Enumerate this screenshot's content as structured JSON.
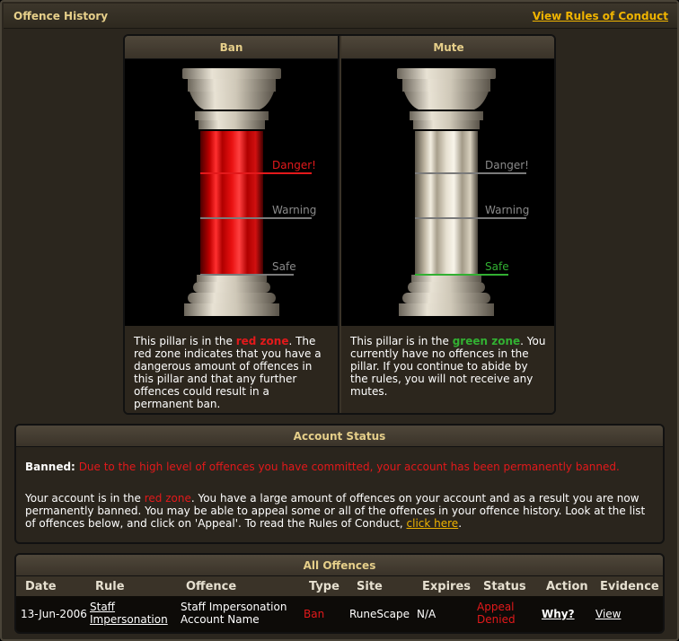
{
  "header": {
    "title": "Offence History",
    "rules_link": "View Rules of Conduct"
  },
  "pillars": [
    {
      "title": "Ban",
      "zone": "red",
      "fill_level": 1.0,
      "labels": {
        "danger": "Danger!",
        "warning": "Warning",
        "safe": "Safe"
      },
      "desc_before": "This pillar is in the ",
      "desc_zone": "red zone",
      "desc_after": ". The red zone indicates that you have a dangerous amount of offences in this pillar and that any further offences could result in a permanent ban."
    },
    {
      "title": "Mute",
      "zone": "green",
      "fill_level": 0.0,
      "labels": {
        "danger": "Danger!",
        "warning": "Warning",
        "safe": "Safe"
      },
      "desc_before": "This pillar is in the ",
      "desc_zone": "green zone",
      "desc_after": ". You currently have no offences in the pillar. If you continue to abide by the rules, you will not receive any mutes."
    }
  ],
  "account_status": {
    "title": "Account Status",
    "banned_label": "Banned:",
    "banned_text": "Due to the high level of offences you have committed, your account has been permanently banned.",
    "para_before": "Your account is in the ",
    "para_zone": "red zone",
    "para_after": ". You have a large amount of offences on your account and as a result you are now permanently banned. You may be able to appeal some or all of the offences in your offence history. Look at the list of offences below, and click on 'Appeal'. To read the Rules of Conduct, ",
    "click_here": "click here",
    "para_end": "."
  },
  "offences": {
    "title": "All Offences",
    "columns": [
      "Date",
      "Rule",
      "Offence",
      "Type",
      "Site",
      "Expires",
      "Status",
      "Action",
      "Evidence"
    ],
    "rows": [
      {
        "date": "13-Jun-2006",
        "rule_line1": "Staff",
        "rule_line2": "Impersonation",
        "offence_line1": "Staff Impersonation",
        "offence_line2": "Account Name",
        "type": "Ban",
        "site": "RuneScape",
        "expires": "N/A",
        "status_line1": "Appeal",
        "status_line2": "Denied",
        "action": "Why?",
        "evidence": "View"
      }
    ]
  },
  "colors": {
    "accent": "#e6cf8a",
    "link": "#f0b400",
    "danger": "#e3191b",
    "safe": "#32b032"
  }
}
